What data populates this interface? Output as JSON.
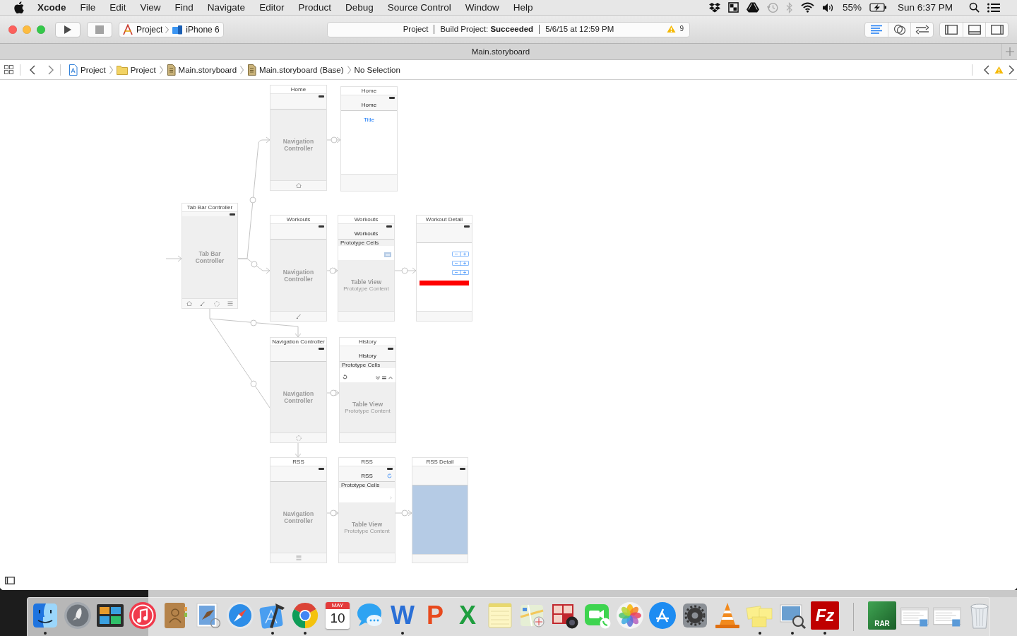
{
  "menu_bar": {
    "app": "Xcode",
    "items": [
      "File",
      "Edit",
      "View",
      "Find",
      "Navigate",
      "Editor",
      "Product",
      "Debug",
      "Source Control",
      "Window",
      "Help"
    ],
    "battery": "55%",
    "clock": "Sun 6:37 PM"
  },
  "toolbar": {
    "scheme": "Project",
    "destination": "iPhone 6",
    "activity": {
      "project": "Project",
      "status": "Build Project: **Succeeded**",
      "time": "5/6/15 at 12:59 PM",
      "warnings": "9"
    },
    "editor_modes": [
      {
        "kind": "standard",
        "selected": true
      },
      {
        "kind": "assistant",
        "selected": false
      },
      {
        "kind": "version",
        "selected": false
      }
    ],
    "panels": [
      {
        "kind": "navigator"
      },
      {
        "kind": "debug"
      },
      {
        "kind": "utilities"
      }
    ]
  },
  "tab": {
    "title": "Main.storyboard"
  },
  "jump_bar": {
    "crumbs": [
      {
        "kind": "project",
        "label": "Project"
      },
      {
        "kind": "folder",
        "label": "Project"
      },
      {
        "kind": "storyboard",
        "label": "Main.storyboard"
      },
      {
        "kind": "storyboard",
        "label": "Main.storyboard (Base)"
      },
      {
        "kind": "plain",
        "label": "No Selection"
      }
    ]
  },
  "scenes": [
    {
      "kind": "tab_bar",
      "title": "Tab Bar Controller",
      "label": "Tab Bar Controller"
    },
    {
      "kind": "navigation",
      "title": "Home",
      "label": "Navigation Controller"
    },
    {
      "kind": "view",
      "title": "Home",
      "nav_title": "Home",
      "heading": "Title"
    },
    {
      "kind": "navigation",
      "title": "Workouts",
      "label": "Navigation Controller"
    },
    {
      "kind": "table",
      "title": "Workouts",
      "nav_title": "Workouts",
      "cells_header": "Prototype Cells",
      "label": "Table View",
      "sublabel": "Prototype Content"
    },
    {
      "kind": "form",
      "title": "Workout Detail"
    },
    {
      "kind": "navigation",
      "title": "Navigation Controller",
      "label": "Navigation Controller"
    },
    {
      "kind": "table",
      "title": "History",
      "nav_title": "History",
      "cells_header": "Prototype Cells",
      "label": "Table View",
      "sublabel": "Prototype Content"
    },
    {
      "kind": "navigation",
      "title": "RSS",
      "label": "Navigation Controller"
    },
    {
      "kind": "table",
      "title": "RSS",
      "nav_title": "RSS",
      "cells_header": "Prototype Cells",
      "label": "Table View",
      "sublabel": "Prototype Content"
    },
    {
      "kind": "web",
      "title": "RSS Detail"
    }
  ],
  "dock": {
    "apps": [
      {
        "kind": "finder",
        "running": true
      },
      {
        "kind": "launchpad",
        "running": false
      },
      {
        "kind": "mission",
        "running": false
      },
      {
        "kind": "itunes",
        "running": false
      },
      {
        "kind": "contacts",
        "running": false
      },
      {
        "kind": "mail",
        "running": false
      },
      {
        "kind": "safari",
        "running": false
      },
      {
        "kind": "xcode",
        "running": true
      },
      {
        "kind": "chrome",
        "running": true
      },
      {
        "kind": "calendar",
        "running": false,
        "month": "MAY",
        "day": "10"
      },
      {
        "kind": "messages",
        "running": false
      },
      {
        "kind": "word",
        "running": true,
        "glyph": "W"
      },
      {
        "kind": "powerpoint",
        "running": false,
        "glyph": "P"
      },
      {
        "kind": "excel",
        "running": false,
        "glyph": "X"
      },
      {
        "kind": "notes",
        "running": false
      },
      {
        "kind": "maps",
        "running": false
      },
      {
        "kind": "photobooth",
        "running": false
      },
      {
        "kind": "facetime",
        "running": false
      },
      {
        "kind": "photos",
        "running": false
      },
      {
        "kind": "appstore",
        "running": false
      },
      {
        "kind": "preferences",
        "running": false
      },
      {
        "kind": "vlc",
        "running": false
      },
      {
        "kind": "stickies",
        "running": true
      },
      {
        "kind": "preview",
        "running": true
      },
      {
        "kind": "filezilla",
        "running": true,
        "glyph": "Fz"
      }
    ],
    "documents": [
      {
        "kind": "archive",
        "glyph": "RAR"
      },
      {
        "kind": "window"
      },
      {
        "kind": "window"
      },
      {
        "kind": "trash"
      }
    ]
  }
}
